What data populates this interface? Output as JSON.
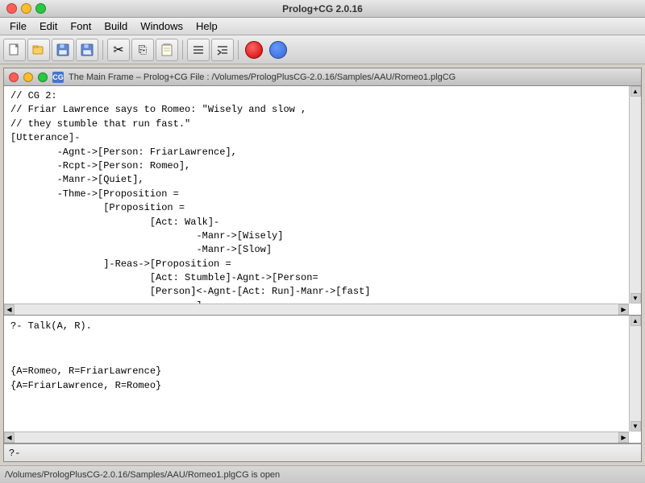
{
  "titleBar": {
    "title": "Prolog+CG 2.0.16"
  },
  "menuBar": {
    "items": [
      "File",
      "Edit",
      "Font",
      "Build",
      "Windows",
      "Help"
    ]
  },
  "toolbar": {
    "buttons": [
      {
        "name": "new-btn",
        "icon": "📄"
      },
      {
        "name": "open-btn",
        "icon": "📂"
      },
      {
        "name": "save-btn",
        "icon": "💾"
      },
      {
        "name": "save-as-btn",
        "icon": "📋"
      },
      {
        "name": "cut-btn",
        "icon": "✂"
      },
      {
        "name": "copy-btn",
        "icon": "⎘"
      },
      {
        "name": "paste-btn",
        "icon": "📌"
      },
      {
        "name": "align-btn",
        "icon": "≡"
      },
      {
        "name": "indent-btn",
        "icon": "⇥"
      }
    ]
  },
  "innerWindow": {
    "title": "The Main Frame – Prolog+CG File : /Volumes/PrologPlusCG-2.0.16/Samples/AAU/Romeo1.plgCG",
    "iconLabel": "CG"
  },
  "editor": {
    "content": "// CG 2:\n// Friar Lawrence says to Romeo: \"Wisely and slow ,\n// they stumble that run fast.\"\n[Utterance]-\n        -Agnt->[Person: FriarLawrence],\n        -Rcpt->[Person: Romeo],\n        -Manr->[Quiet],\n        -Thme->[Proposition =\n                [Proposition =\n                        [Act: Walk]-\n                                -Manr->[Wisely]\n                                -Manr->[Slow]\n                ]-Reas->[Proposition =\n                        [Act: Stumble]-Agnt->[Person=\n                        [Person]<-Agnt-[Act: Run]-Manr->[fast]\n                                ]\n                ]\n        ]"
  },
  "outputPane": {
    "content": "?- Talk(A, R).\n\n\n{A=Romeo, R=FriarLawrence}\n{A=FriarLawrence, R=Romeo}"
  },
  "inputBar": {
    "prompt": "?-"
  },
  "statusBar": {
    "text": "/Volumes/PrologPlusCG-2.0.16/Samples/AAU/Romeo1.plgCG is open"
  }
}
